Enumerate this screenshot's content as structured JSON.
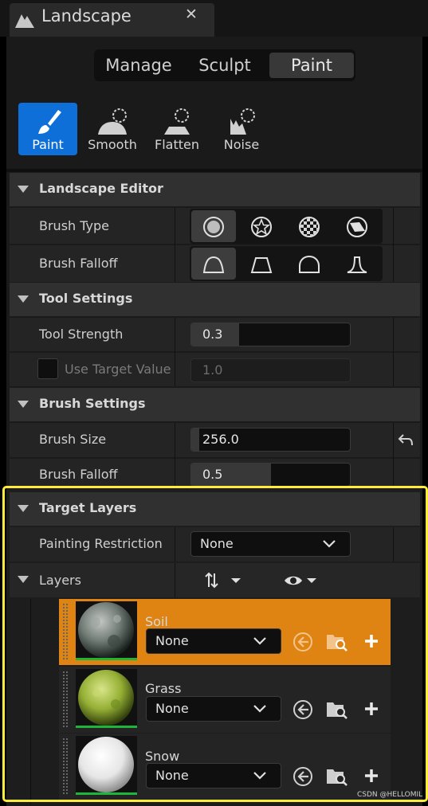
{
  "window": {
    "title": "Landscape",
    "close_symbol": "✕"
  },
  "modes": [
    "Manage",
    "Sculpt",
    "Paint"
  ],
  "active_mode": "Paint",
  "tools": [
    {
      "label": "Paint",
      "icon": "paint-brush-icon",
      "active": true
    },
    {
      "label": "Smooth",
      "icon": "smooth-icon",
      "active": false
    },
    {
      "label": "Flatten",
      "icon": "flatten-icon",
      "active": false
    },
    {
      "label": "Noise",
      "icon": "noise-icon",
      "active": false
    }
  ],
  "sections": {
    "landscape_editor": "Landscape Editor",
    "tool_settings": "Tool Settings",
    "brush_settings": "Brush Settings",
    "target_layers": "Target Layers"
  },
  "brush_type": {
    "label": "Brush Type",
    "options": [
      "circle-brush-icon",
      "alpha-brush-icon",
      "pattern-brush-icon",
      "component-brush-icon"
    ],
    "selected": 0
  },
  "brush_falloff_shape": {
    "label": "Brush Falloff",
    "options": [
      "smooth-falloff-icon",
      "linear-falloff-icon",
      "spherical-falloff-icon",
      "tip-falloff-icon"
    ],
    "selected": 0
  },
  "tool_strength": {
    "label": "Tool Strength",
    "value": "0.3",
    "fraction": 0.3
  },
  "use_target_value": {
    "label": "Use Target Value",
    "checked": false,
    "value": "1.0"
  },
  "brush_size": {
    "label": "Brush Size",
    "value": "256.0",
    "fraction": 0.05
  },
  "brush_falloff": {
    "label": "Brush Falloff",
    "value": "0.5",
    "fraction": 0.5
  },
  "painting_restriction": {
    "label": "Painting Restriction",
    "value": "None"
  },
  "layers_header": {
    "label": "Layers"
  },
  "layers": [
    {
      "name": "Soil",
      "value": "None",
      "selected": true
    },
    {
      "name": "Grass",
      "value": "None",
      "selected": false
    },
    {
      "name": "Snow",
      "value": "None",
      "selected": false
    }
  ],
  "colors": {
    "accent_blue": "#0e6fd8",
    "selected_layer": "#df8413",
    "highlight_border": "#ffeb3b",
    "layer_bar": "#1db53a"
  },
  "watermark": "CSDN @HELLOMIL"
}
